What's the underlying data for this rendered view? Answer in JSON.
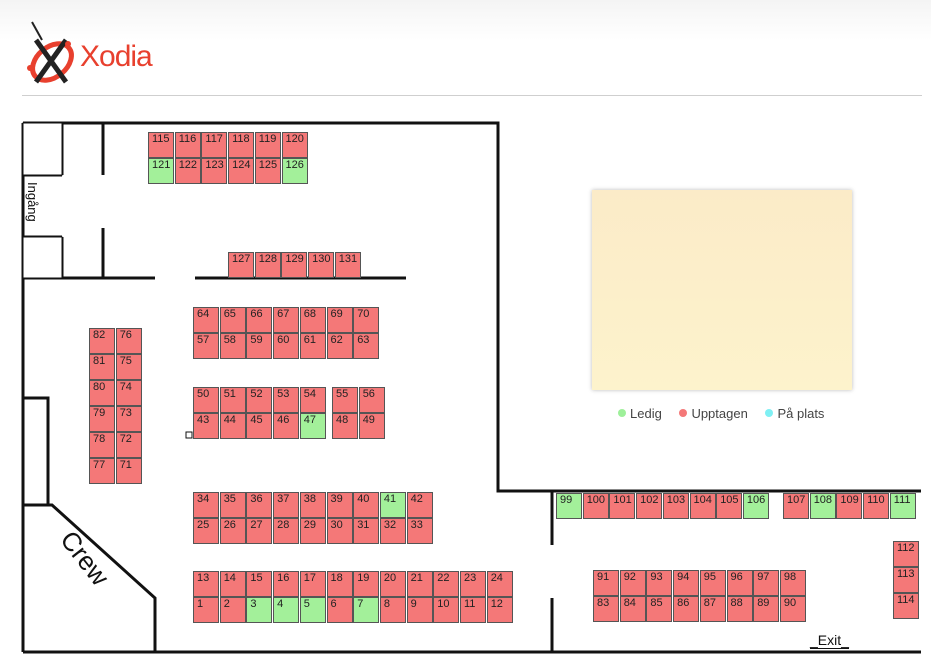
{
  "brand": {
    "name": "Xodia"
  },
  "labels": {
    "entrance": "Ingång",
    "crew": "Crew",
    "exit": "_Exit_"
  },
  "legend": [
    {
      "label": "Ledig",
      "color": "#9ef09a"
    },
    {
      "label": "Upptagen",
      "color": "#f47878"
    },
    {
      "label": "På plats",
      "color": "#7ff0f4"
    }
  ],
  "seats": [
    {
      "n": "115"
    },
    {
      "n": "116"
    },
    {
      "n": "117"
    },
    {
      "n": "118"
    },
    {
      "n": "119"
    },
    {
      "n": "120"
    },
    {
      "n": "121",
      "s": "free"
    },
    {
      "n": "122"
    },
    {
      "n": "123"
    },
    {
      "n": "124"
    },
    {
      "n": "125"
    },
    {
      "n": "126",
      "s": "free"
    },
    {
      "n": "127"
    },
    {
      "n": "128"
    },
    {
      "n": "129"
    },
    {
      "n": "130"
    },
    {
      "n": "131"
    },
    {
      "n": "64"
    },
    {
      "n": "65"
    },
    {
      "n": "66"
    },
    {
      "n": "67"
    },
    {
      "n": "68"
    },
    {
      "n": "69"
    },
    {
      "n": "70"
    },
    {
      "n": "57"
    },
    {
      "n": "58"
    },
    {
      "n": "59"
    },
    {
      "n": "60"
    },
    {
      "n": "61"
    },
    {
      "n": "62"
    },
    {
      "n": "63"
    },
    {
      "n": "50"
    },
    {
      "n": "51"
    },
    {
      "n": "52"
    },
    {
      "n": "53"
    },
    {
      "n": "54"
    },
    {
      "n": "55"
    },
    {
      "n": "56"
    },
    {
      "n": "43"
    },
    {
      "n": "44"
    },
    {
      "n": "45"
    },
    {
      "n": "46"
    },
    {
      "n": "47",
      "s": "free"
    },
    {
      "n": "48"
    },
    {
      "n": "49"
    },
    {
      "n": "82"
    },
    {
      "n": "76"
    },
    {
      "n": "81"
    },
    {
      "n": "75"
    },
    {
      "n": "80"
    },
    {
      "n": "74"
    },
    {
      "n": "79"
    },
    {
      "n": "73"
    },
    {
      "n": "78"
    },
    {
      "n": "72"
    },
    {
      "n": "77"
    },
    {
      "n": "71"
    },
    {
      "n": "34"
    },
    {
      "n": "35"
    },
    {
      "n": "36"
    },
    {
      "n": "37"
    },
    {
      "n": "38"
    },
    {
      "n": "39"
    },
    {
      "n": "40"
    },
    {
      "n": "41",
      "s": "free"
    },
    {
      "n": "42"
    },
    {
      "n": "25"
    },
    {
      "n": "26"
    },
    {
      "n": "27"
    },
    {
      "n": "28"
    },
    {
      "n": "29"
    },
    {
      "n": "30"
    },
    {
      "n": "31"
    },
    {
      "n": "32"
    },
    {
      "n": "33"
    },
    {
      "n": "13"
    },
    {
      "n": "14"
    },
    {
      "n": "15"
    },
    {
      "n": "16"
    },
    {
      "n": "17"
    },
    {
      "n": "18"
    },
    {
      "n": "19"
    },
    {
      "n": "20"
    },
    {
      "n": "21"
    },
    {
      "n": "22"
    },
    {
      "n": "23"
    },
    {
      "n": "24"
    },
    {
      "n": "1"
    },
    {
      "n": "2"
    },
    {
      "n": "3",
      "s": "free"
    },
    {
      "n": "4",
      "s": "free"
    },
    {
      "n": "5",
      "s": "free"
    },
    {
      "n": "6"
    },
    {
      "n": "7",
      "s": "free"
    },
    {
      "n": "8"
    },
    {
      "n": "9"
    },
    {
      "n": "10"
    },
    {
      "n": "11"
    },
    {
      "n": "12"
    },
    {
      "n": "99",
      "s": "free"
    },
    {
      "n": "100"
    },
    {
      "n": "101"
    },
    {
      "n": "102"
    },
    {
      "n": "103"
    },
    {
      "n": "104"
    },
    {
      "n": "105"
    },
    {
      "n": "106",
      "s": "free"
    },
    {
      "n": "107"
    },
    {
      "n": "108",
      "s": "free"
    },
    {
      "n": "109"
    },
    {
      "n": "110"
    },
    {
      "n": "111",
      "s": "free"
    },
    {
      "n": "91"
    },
    {
      "n": "92"
    },
    {
      "n": "93"
    },
    {
      "n": "94"
    },
    {
      "n": "95"
    },
    {
      "n": "96"
    },
    {
      "n": "97"
    },
    {
      "n": "98"
    },
    {
      "n": "83"
    },
    {
      "n": "84"
    },
    {
      "n": "85"
    },
    {
      "n": "86"
    },
    {
      "n": "87"
    },
    {
      "n": "88"
    },
    {
      "n": "89"
    },
    {
      "n": "90"
    },
    {
      "n": "112"
    },
    {
      "n": "113"
    },
    {
      "n": "114"
    }
  ]
}
